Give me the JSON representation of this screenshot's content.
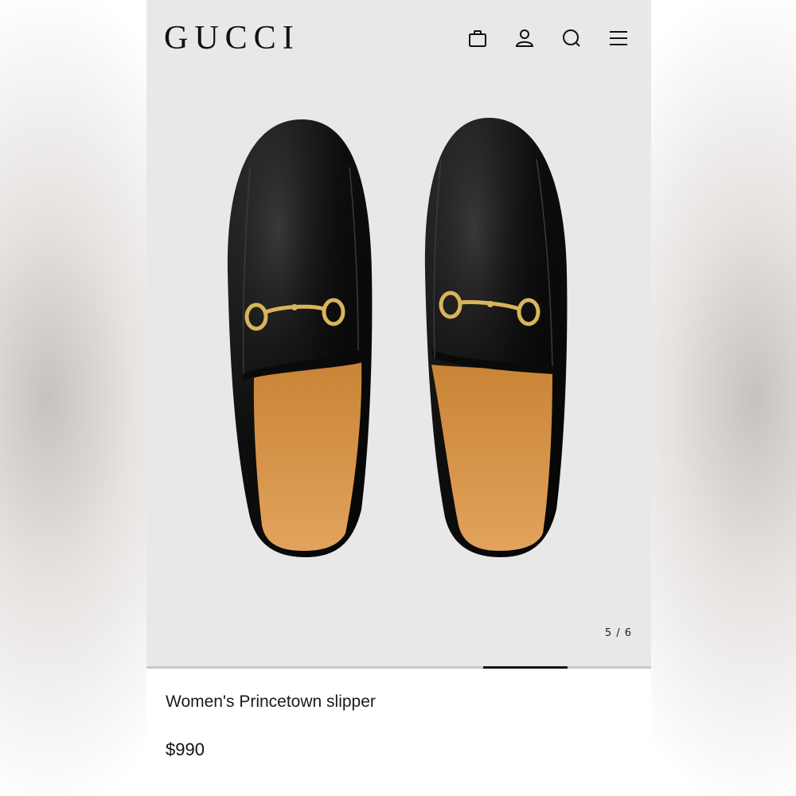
{
  "brand": {
    "logo_text": "GUCCI"
  },
  "header": {
    "icons": [
      "shopping-bag-icon",
      "account-icon",
      "search-icon",
      "menu-icon"
    ]
  },
  "gallery": {
    "counter": "5 / 6",
    "current": 5,
    "total": 6,
    "image_subject": "Black leather horsebit backless slippers with tan insole, top view"
  },
  "product": {
    "name": "Women's Princetown slipper",
    "price": "$990"
  },
  "colors": {
    "hero_background": "#e8e8e8",
    "progress_track": "#c9c9c9",
    "progress_fill": "#111111",
    "text": "#111111"
  }
}
